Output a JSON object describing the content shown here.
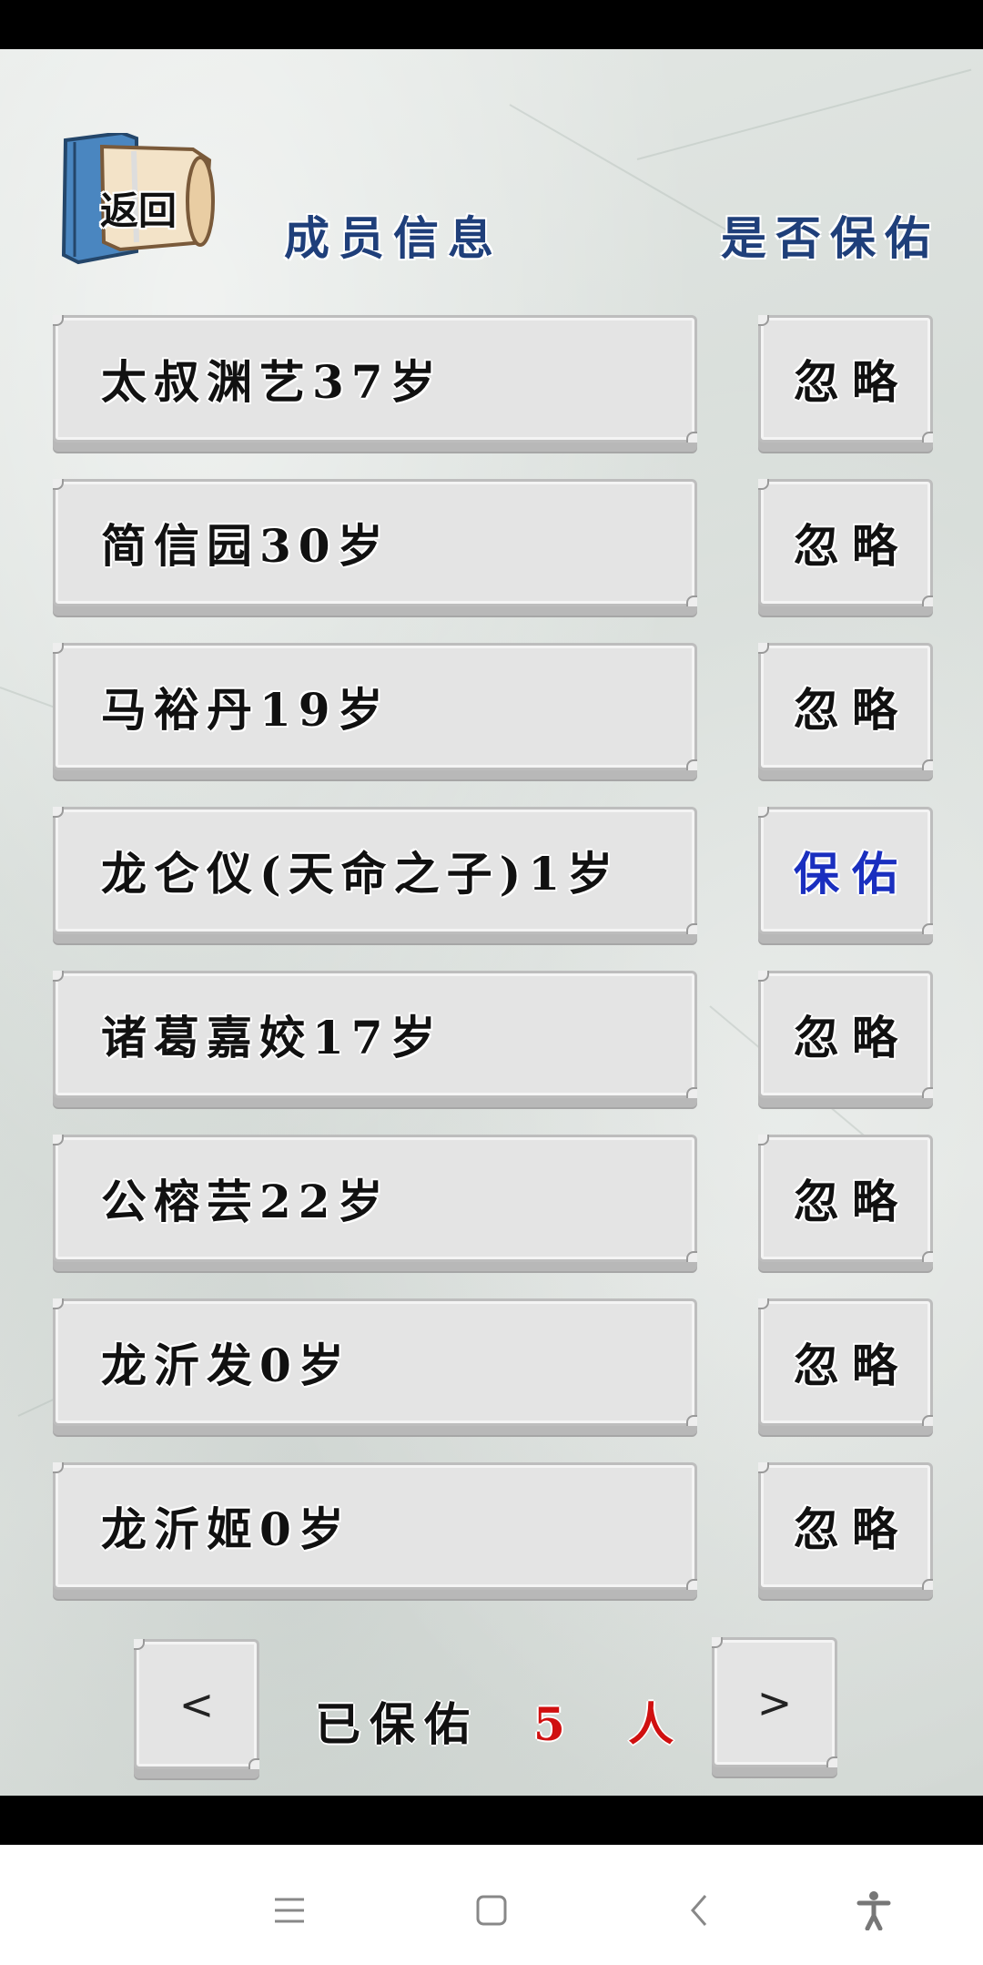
{
  "back_button": {
    "label": "返回"
  },
  "headers": {
    "member_info": "成员信息",
    "protect_status": "是否保佑"
  },
  "members": [
    {
      "name": "太叔渊艺37岁",
      "action": "忽略",
      "protected": false
    },
    {
      "name": "简信园30岁",
      "action": "忽略",
      "protected": false
    },
    {
      "name": "马裕丹19岁",
      "action": "忽略",
      "protected": false
    },
    {
      "name": "龙仑仪(天命之子)1岁",
      "action": "保佑",
      "protected": true
    },
    {
      "name": "诸葛嘉姣17岁",
      "action": "忽略",
      "protected": false
    },
    {
      "name": "公榕芸22岁",
      "action": "忽略",
      "protected": false
    },
    {
      "name": "龙沂发0岁",
      "action": "忽略",
      "protected": false
    },
    {
      "name": "龙沂姬0岁",
      "action": "忽略",
      "protected": false
    }
  ],
  "pager": {
    "prev_label": "<",
    "next_label": ">",
    "protected_label": "已保佑",
    "protected_count": "5 人"
  },
  "colors": {
    "header": "#1f3f7a",
    "protected_action": "#1a2fbf",
    "count": "#d01010"
  },
  "nav_icons": [
    "menu-icon",
    "home-square-icon",
    "back-chevron-icon",
    "accessibility-icon"
  ]
}
